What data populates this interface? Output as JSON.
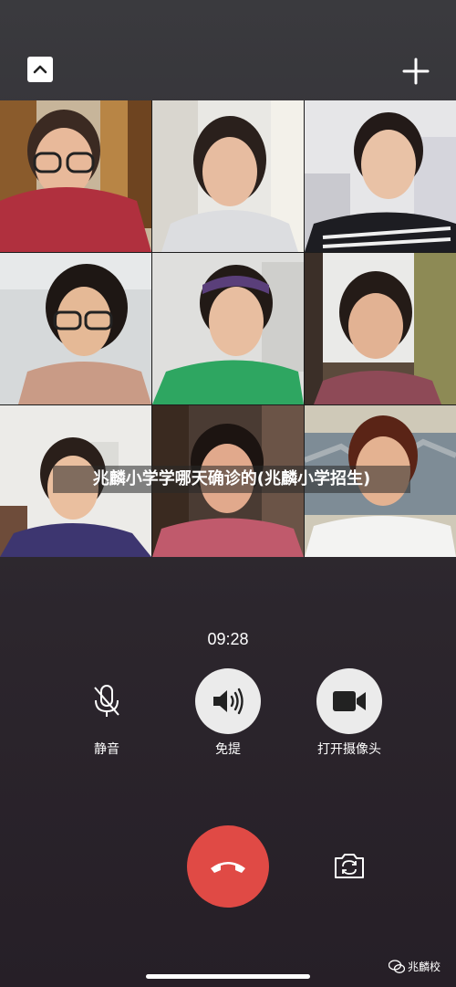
{
  "call": {
    "timer": "09:28",
    "caption": "兆麟小学学哪天确诊的(兆麟小学招生)"
  },
  "controls": {
    "mute_label": "静音",
    "speaker_label": "免提",
    "camera_label": "打开摄像头"
  },
  "icons": {
    "collapse": "chevron-up-icon",
    "add": "plus-icon",
    "mute": "microphone-icon",
    "speaker": "speaker-icon",
    "camera": "video-camera-icon",
    "hangup": "phone-hangup-icon",
    "switch_camera": "camera-switch-icon",
    "wechat": "wechat-icon"
  },
  "participants_count": 9,
  "watermark": {
    "text": "兆麟校"
  },
  "colors": {
    "hangup": "#e04a45",
    "control_fill": "#ebebeb",
    "background": "#2c262d"
  }
}
